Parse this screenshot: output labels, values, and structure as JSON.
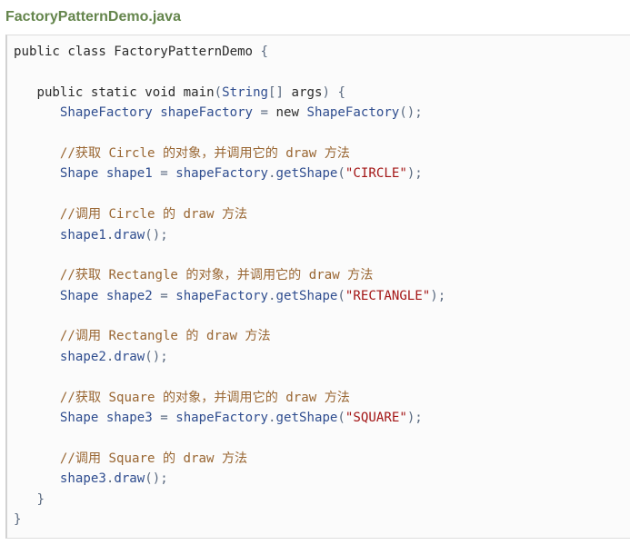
{
  "file": {
    "title": "FactoryPatternDemo.java"
  },
  "code": {
    "lines": [
      [
        {
          "t": "public class FactoryPatternDemo",
          "c": "tok-plain"
        },
        {
          "t": " {",
          "c": "tok-punc"
        }
      ],
      [],
      [
        {
          "t": "   public static void main",
          "c": "tok-plain"
        },
        {
          "t": "(",
          "c": "tok-punc"
        },
        {
          "t": "String",
          "c": "tok-type"
        },
        {
          "t": "[] ",
          "c": "tok-punc"
        },
        {
          "t": "args",
          "c": "tok-plain"
        },
        {
          "t": ") {",
          "c": "tok-punc"
        }
      ],
      [
        {
          "t": "      ShapeFactory shapeFactory ",
          "c": "tok-type"
        },
        {
          "t": "= ",
          "c": "tok-punc"
        },
        {
          "t": "new ",
          "c": "tok-plain"
        },
        {
          "t": "ShapeFactory",
          "c": "tok-type"
        },
        {
          "t": "();",
          "c": "tok-punc"
        }
      ],
      [],
      [
        {
          "t": "      //获取 Circle 的对象，并调用它的 draw 方法",
          "c": "tok-cmt"
        }
      ],
      [
        {
          "t": "      Shape shape1 ",
          "c": "tok-type"
        },
        {
          "t": "= ",
          "c": "tok-punc"
        },
        {
          "t": "shapeFactory",
          "c": "tok-type"
        },
        {
          "t": ".",
          "c": "tok-punc"
        },
        {
          "t": "getShape",
          "c": "tok-type"
        },
        {
          "t": "(",
          "c": "tok-punc"
        },
        {
          "t": "\"CIRCLE\"",
          "c": "tok-str"
        },
        {
          "t": ");",
          "c": "tok-punc"
        }
      ],
      [],
      [
        {
          "t": "      //调用 Circle 的 draw 方法",
          "c": "tok-cmt"
        }
      ],
      [
        {
          "t": "      shape1",
          "c": "tok-type"
        },
        {
          "t": ".",
          "c": "tok-punc"
        },
        {
          "t": "draw",
          "c": "tok-type"
        },
        {
          "t": "();",
          "c": "tok-punc"
        }
      ],
      [],
      [
        {
          "t": "      //获取 Rectangle 的对象，并调用它的 draw 方法",
          "c": "tok-cmt"
        }
      ],
      [
        {
          "t": "      Shape shape2 ",
          "c": "tok-type"
        },
        {
          "t": "= ",
          "c": "tok-punc"
        },
        {
          "t": "shapeFactory",
          "c": "tok-type"
        },
        {
          "t": ".",
          "c": "tok-punc"
        },
        {
          "t": "getShape",
          "c": "tok-type"
        },
        {
          "t": "(",
          "c": "tok-punc"
        },
        {
          "t": "\"RECTANGLE\"",
          "c": "tok-str"
        },
        {
          "t": ");",
          "c": "tok-punc"
        }
      ],
      [],
      [
        {
          "t": "      //调用 Rectangle 的 draw 方法",
          "c": "tok-cmt"
        }
      ],
      [
        {
          "t": "      shape2",
          "c": "tok-type"
        },
        {
          "t": ".",
          "c": "tok-punc"
        },
        {
          "t": "draw",
          "c": "tok-type"
        },
        {
          "t": "();",
          "c": "tok-punc"
        }
      ],
      [],
      [
        {
          "t": "      //获取 Square 的对象，并调用它的 draw 方法",
          "c": "tok-cmt"
        }
      ],
      [
        {
          "t": "      Shape shape3 ",
          "c": "tok-type"
        },
        {
          "t": "= ",
          "c": "tok-punc"
        },
        {
          "t": "shapeFactory",
          "c": "tok-type"
        },
        {
          "t": ".",
          "c": "tok-punc"
        },
        {
          "t": "getShape",
          "c": "tok-type"
        },
        {
          "t": "(",
          "c": "tok-punc"
        },
        {
          "t": "\"SQUARE\"",
          "c": "tok-str"
        },
        {
          "t": ");",
          "c": "tok-punc"
        }
      ],
      [],
      [
        {
          "t": "      //调用 Square 的 draw 方法",
          "c": "tok-cmt"
        }
      ],
      [
        {
          "t": "      shape3",
          "c": "tok-type"
        },
        {
          "t": ".",
          "c": "tok-punc"
        },
        {
          "t": "draw",
          "c": "tok-type"
        },
        {
          "t": "();",
          "c": "tok-punc"
        }
      ],
      [
        {
          "t": "   }",
          "c": "tok-punc"
        }
      ],
      [
        {
          "t": "}",
          "c": "tok-punc"
        }
      ]
    ]
  }
}
